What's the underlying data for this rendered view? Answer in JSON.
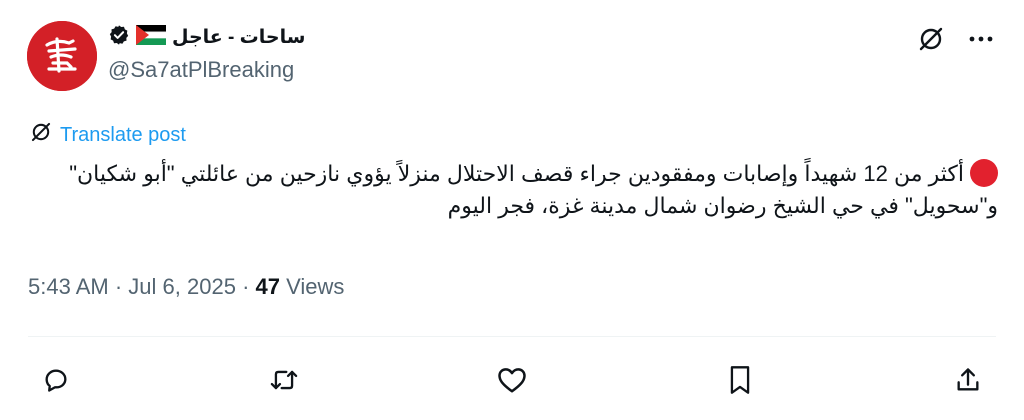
{
  "author": {
    "display_name": "ساحات - عاجل",
    "handle": "@Sa7atPlBreaking",
    "verified": true,
    "flag": "palestine-flag",
    "avatar_color": "#d32027"
  },
  "top_actions": {
    "grok_icon": "grok-icon",
    "more_icon": "more-icon"
  },
  "translate": {
    "label": "Translate post"
  },
  "tweet": {
    "text": "أكثر من 12 شهيداً وإصابات ومفقودين جراء قصف الاحتلال منزلاً يؤوي نازحين من عائلتي \"أبو شكيان\" و\"سحويل\" في حي الشيخ رضوان شمال مدينة غزة، فجر اليوم"
  },
  "meta": {
    "time": "5:43 AM",
    "date": "Jul 6, 2025",
    "views_count": "47",
    "views_label": "Views",
    "separator": "·"
  },
  "actions": [
    "reply-icon",
    "retweet-icon",
    "like-icon",
    "bookmark-icon",
    "share-icon"
  ],
  "colors": {
    "link": "#1d9bf0",
    "secondary": "#536471",
    "primary_text": "#0f1419"
  }
}
